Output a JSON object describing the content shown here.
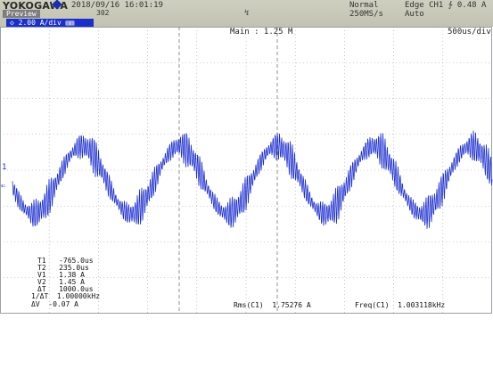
{
  "header": {
    "brand": "YOKOGAWA",
    "datetime": "2018/09/16  16:01:19",
    "preview": "Preview",
    "record": "302",
    "trigger_marker": "↯",
    "acq_mode": "Normal",
    "sample_rate": "250MS/s",
    "trigger_edge": "Edge CH1 ∱ 0.48 A",
    "trigger_mode": "Auto",
    "channel_tag": "◇ 2.00 A/div ▤▥",
    "accent": "#1a30c8"
  },
  "screen": {
    "main": "Main : 1.25 M",
    "timebase": "500us/div",
    "trace_color": "#1c2fd0",
    "grid_color": "#9aa0a6",
    "ground_marker": "1",
    "level_marker": "⇐"
  },
  "cursors": {
    "t1": "T1   -765.0us",
    "t2": "T2   235.0us",
    "v1": "V1   1.38 A",
    "v2": "V2   1.45 A",
    "dt": "ΔT   1000.0us",
    "inv_dt": "1/ΔT  1.00000kHz",
    "dv": "ΔV  -0.07 A"
  },
  "measurements": {
    "rms": "Rms(C1)  1.75276 A",
    "freq": "Freq(C1)  1.003118kHz"
  },
  "chart_data": {
    "type": "line",
    "title": "",
    "xlabel": "",
    "ylabel": "",
    "series": [
      {
        "name": "",
        "frequency_hz": 1003.118,
        "rms_a": 1.75276
      }
    ]
  }
}
